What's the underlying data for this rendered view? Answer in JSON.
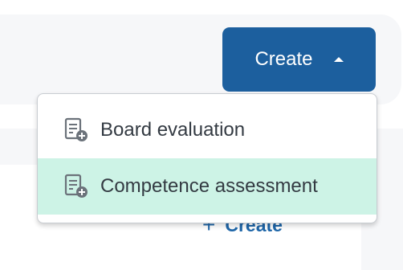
{
  "create_button": {
    "label": "Create",
    "caret_icon": "caret-up-icon"
  },
  "dropdown": {
    "items": [
      {
        "label": "Board evaluation",
        "icon": "document-add-icon",
        "highlighted": false
      },
      {
        "label": "Competence assessment",
        "icon": "document-add-icon",
        "highlighted": true
      }
    ]
  },
  "background_action": {
    "label": "Create",
    "icon": "plus-icon"
  },
  "colors": {
    "primary": "#1c5f9e",
    "highlight": "#cdf3e6",
    "link": "#1f66a8",
    "text": "#333a42"
  }
}
